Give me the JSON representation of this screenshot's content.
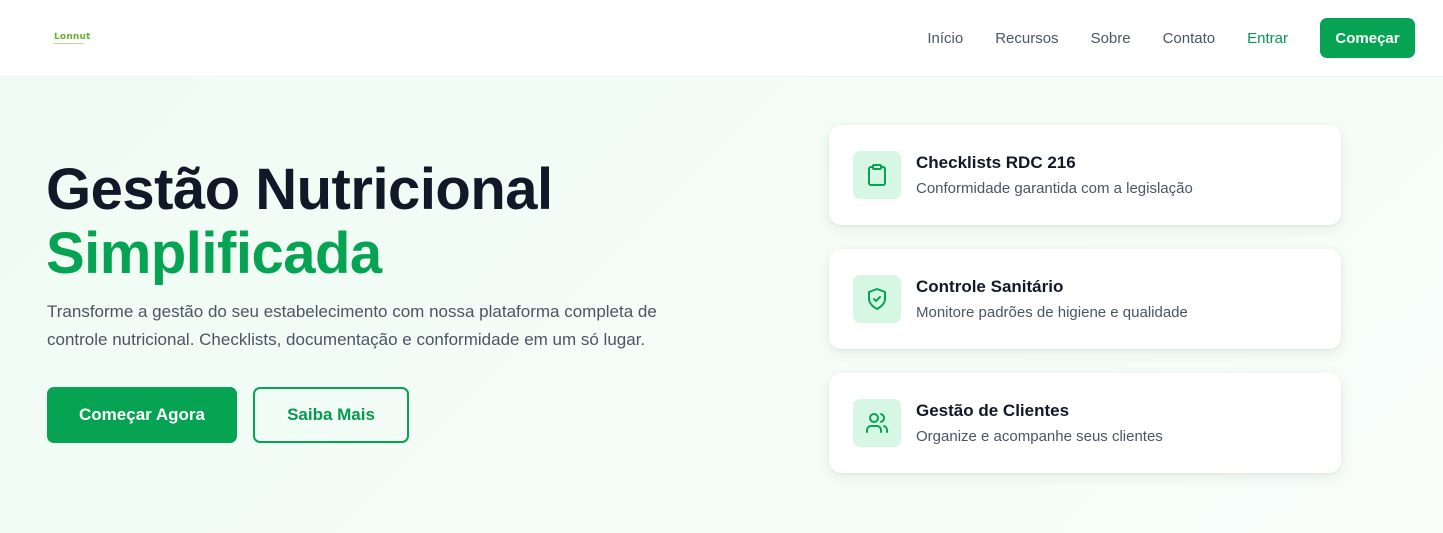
{
  "brand": {
    "logo_text": "Lonnut"
  },
  "nav": {
    "links": [
      "Início",
      "Recursos",
      "Sobre",
      "Contato"
    ],
    "login_label": "Entrar",
    "start_label": "Começar"
  },
  "hero": {
    "title_line1": "Gestão Nutricional",
    "title_line2": "Simplificada",
    "description": "Transforme a gestão do seu estabelecimento com nossa plataforma completa de controle nutricional. Checklists, documentação e conformidade em um só lugar.",
    "primary_cta": "Começar Agora",
    "secondary_cta": "Saiba Mais"
  },
  "features": [
    {
      "icon": "clipboard-icon",
      "title": "Checklists RDC 216",
      "subtitle": "Conformidade garantida com a legislação"
    },
    {
      "icon": "shield-check-icon",
      "title": "Controle Sanitário",
      "subtitle": "Monitore padrões de higiene e qualidade"
    },
    {
      "icon": "users-icon",
      "title": "Gestão de Clientes",
      "subtitle": "Organize e acompanhe seus clientes"
    }
  ],
  "colors": {
    "brand_green": "#05a352",
    "text_dark": "#111827",
    "text_muted": "#4b5563",
    "icon_bg": "#d6f7e3"
  }
}
